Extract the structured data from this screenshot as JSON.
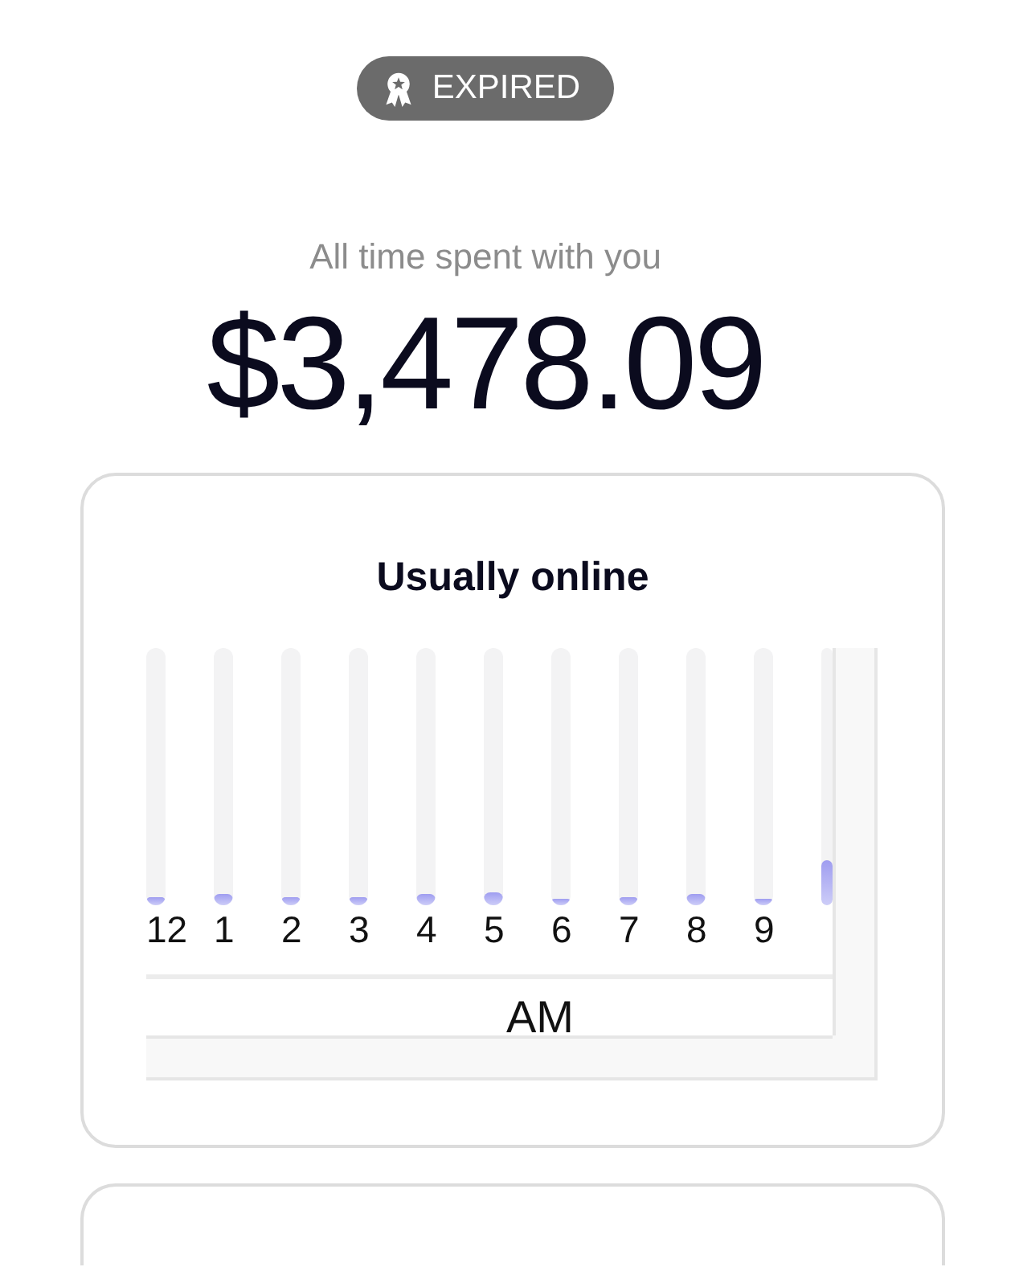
{
  "status_badge": {
    "label": "EXPIRED"
  },
  "spending": {
    "label": "All time spent with you",
    "amount": "$3,478.09"
  },
  "activity_card": {
    "title": "Usually online",
    "hours": [
      {
        "label": "12",
        "level": 0.03
      },
      {
        "label": "1",
        "level": 0.045
      },
      {
        "label": "2",
        "level": 0.03
      },
      {
        "label": "3",
        "level": 0.03
      },
      {
        "label": "4",
        "level": 0.045
      },
      {
        "label": "5",
        "level": 0.05
      },
      {
        "label": "6",
        "level": 0.025
      },
      {
        "label": "7",
        "level": 0.03
      },
      {
        "label": "8",
        "level": 0.045
      },
      {
        "label": "9",
        "level": 0.025
      },
      {
        "level": 0.175
      }
    ],
    "period": "AM"
  }
}
